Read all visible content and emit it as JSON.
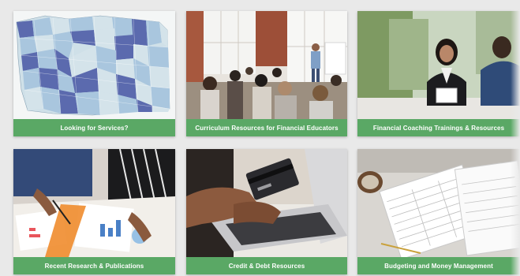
{
  "cards": [
    {
      "label": "Looking for Services?",
      "image": "washington-county-map"
    },
    {
      "label": "Curriculum Resources for Financial Educators",
      "image": "classroom-presenter-photo"
    },
    {
      "label": "Financial Coaching Trainings & Resources",
      "image": "coaching-meeting-photo"
    },
    {
      "label": "Recent Research & Publications",
      "image": "research-documents-photo"
    },
    {
      "label": "Credit & Debt Resources",
      "image": "credit-card-laptop-photo"
    },
    {
      "label": "Budgeting and Money Management",
      "image": "budget-paperwork-photo"
    }
  ],
  "colors": {
    "label_bar": "#5aa865",
    "label_text": "#ffffff",
    "map_dark": "#5b6aae",
    "map_mid": "#a9c6de",
    "map_light": "#d4e3ea"
  }
}
